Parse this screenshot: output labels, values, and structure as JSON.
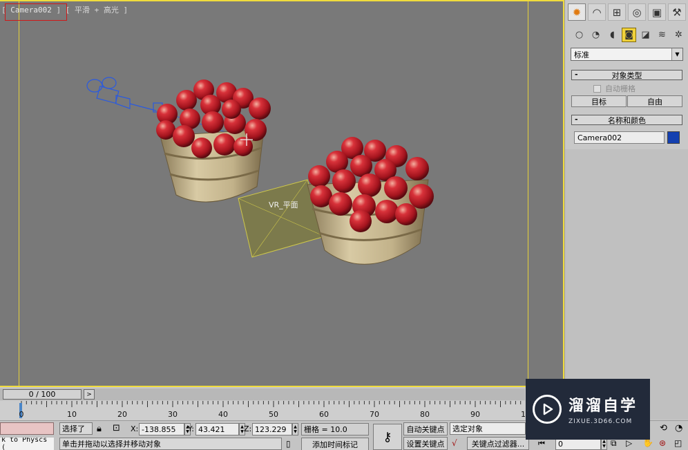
{
  "viewport": {
    "label_left": "[",
    "camera": "Camera002",
    "label_right": "] [ 平滑 + 高光 ]",
    "plane_label": "VR_平面"
  },
  "command_panel": {
    "tabs": [
      "create-icon",
      "modify-icon",
      "hierarchy-icon",
      "motion-icon",
      "display-icon",
      "utilities-icon"
    ],
    "subtabs": [
      "geometry-icon",
      "shapes-icon",
      "lights-icon",
      "cameras-icon",
      "helpers-icon",
      "spacewarps-icon",
      "systems-icon"
    ],
    "category": "标准",
    "object_type": {
      "title": "对象类型",
      "autogrid": "自动栅格",
      "buttons": [
        "目标",
        "自由"
      ]
    },
    "name_color": {
      "title": "名称和颜色",
      "name": "Camera002",
      "color": "#1440b0"
    }
  },
  "timeline": {
    "frame": "0 / 100",
    "next": ">",
    "current_frame": 0,
    "ruler_labels": [
      "0",
      "10",
      "20",
      "30",
      "40",
      "50",
      "60",
      "70",
      "80",
      "90",
      "10"
    ]
  },
  "status": {
    "physcs": "k to Physcs (",
    "selected": "选择了",
    "x_label": "X:",
    "x_value": "-138.855",
    "y_label": "Y:",
    "y_value": "43.421",
    "z_label": "Z:",
    "z_value": "123.229",
    "grid": "栅格 = 10.0",
    "prompt": "单击并拖动以选择并移动对象",
    "add_time_tag": "添加时间标记",
    "auto_key": "自动关键点",
    "set_key": "设置关键点",
    "selected_object": "选定对象",
    "key_filter": "关键点过滤器...",
    "frame_field": "0"
  },
  "watermark": {
    "title": "溜溜自学",
    "url": "ZIXUE.3D66.COM"
  }
}
